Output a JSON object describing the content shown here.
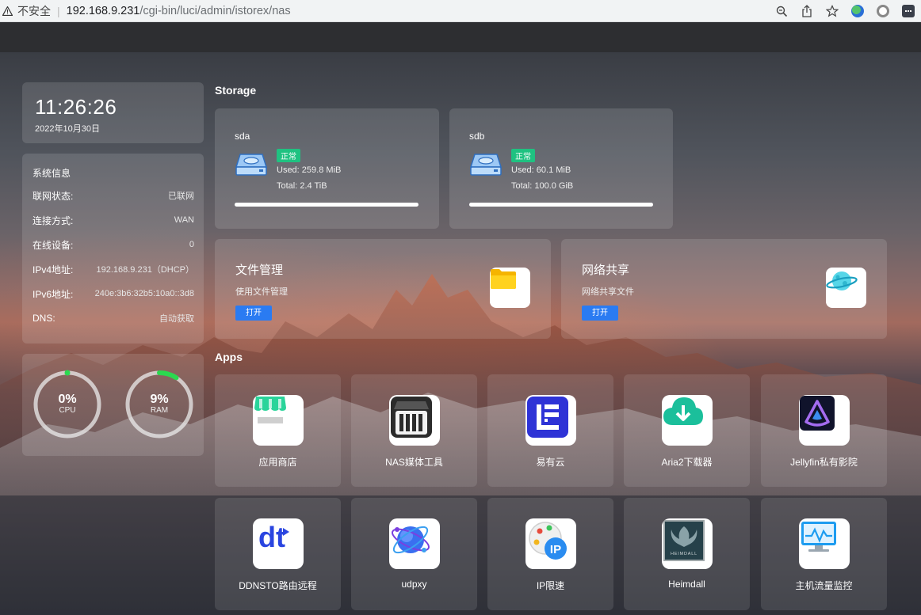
{
  "browser": {
    "insecure_label": "不安全",
    "url_host": "192.168.9.231",
    "url_path": "/cgi-bin/luci/admin/istorex/nas"
  },
  "clock": {
    "time": "11:26:26",
    "date": "2022年10月30日"
  },
  "sysinfo": {
    "title": "系统信息",
    "rows": [
      {
        "key": "联网状态:",
        "value": "已联网"
      },
      {
        "key": "连接方式:",
        "value": "WAN"
      },
      {
        "key": "在线设备:",
        "value": "0"
      },
      {
        "key": "IPv4地址:",
        "value": "192.168.9.231（DHCP）"
      },
      {
        "key": "IPv6地址:",
        "value": "240e:3b6:32b5:10a0::3d8"
      },
      {
        "key": "DNS:",
        "value": "自动获取"
      }
    ]
  },
  "gauges": {
    "cpu": {
      "value": "0%",
      "label": "CPU",
      "fraction": 0.0
    },
    "ram": {
      "value": "9%",
      "label": "RAM",
      "fraction": 0.09
    }
  },
  "storage": {
    "title": "Storage",
    "disks": [
      {
        "name": "sda",
        "status": "正常",
        "used": "Used: 259.8 MiB",
        "total": "Total: 2.4 TiB",
        "fraction": 0.0001
      },
      {
        "name": "sdb",
        "status": "正常",
        "used": "Used: 60.1 MiB",
        "total": "Total: 100.0 GiB",
        "fraction": 0.0006
      }
    ]
  },
  "features": [
    {
      "title": "文件管理",
      "subtitle": "使用文件管理",
      "button": "打开"
    },
    {
      "title": "网络共享",
      "subtitle": "网络共享文件",
      "button": "打开"
    }
  ],
  "apps": {
    "title": "Apps",
    "items": [
      {
        "label": "应用商店"
      },
      {
        "label": "NAS媒体工具"
      },
      {
        "label": "易有云"
      },
      {
        "label": "Aria2下载器"
      },
      {
        "label": "Jellyfin私有影院"
      },
      {
        "label": "DDNSTO路由远程",
        "icon_text": "dt"
      },
      {
        "label": "udpxy"
      },
      {
        "label": "IP限速",
        "icon_text": "IP"
      },
      {
        "label": "Heimdall",
        "icon_text": "HEIMDALL"
      },
      {
        "label": "主机流量监控"
      }
    ]
  },
  "colors": {
    "accent": "#2a7bf2",
    "status_ok": "#1fc281",
    "gauge_active": "#2bd94f"
  }
}
